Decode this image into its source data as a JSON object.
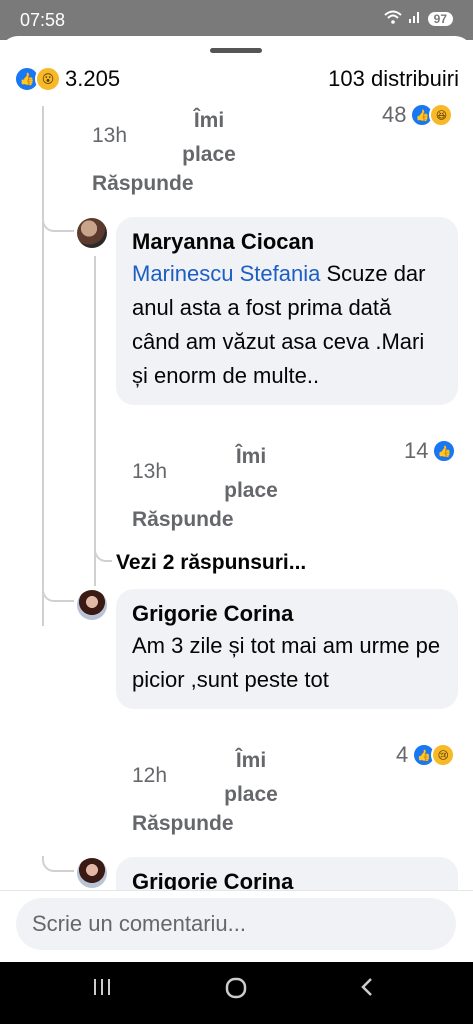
{
  "status": {
    "time": "07:58",
    "battery": "97"
  },
  "summary": {
    "reaction_count": "3.205",
    "shares": "103 distribuiri"
  },
  "actions": {
    "like": "Îmi place",
    "reply": "Răspunde"
  },
  "comments": [
    {
      "time": "13h",
      "reactions": "48"
    },
    {
      "author": "Maryanna Ciocan",
      "mention": "Marinescu Stefania",
      "text": " Scuze dar anul asta a fost prima dată când am văzut asa ceva .Mari și enorm de multe..",
      "time": "13h",
      "reactions": "14"
    },
    {
      "author": "Grigorie Corina",
      "text": "Am 3 zile și tot mai am urme pe picior ,sunt peste tot",
      "time": "12h",
      "reactions": "4"
    },
    {
      "author": "Grigorie Corina"
    }
  ],
  "more_replies": "Vezi 2 răspunsuri...",
  "composer": {
    "placeholder": "Scrie un comentariu..."
  },
  "colors": {
    "link": "#1d5ec5",
    "bubble": "#f0f2f5",
    "like": "#1877f2"
  }
}
